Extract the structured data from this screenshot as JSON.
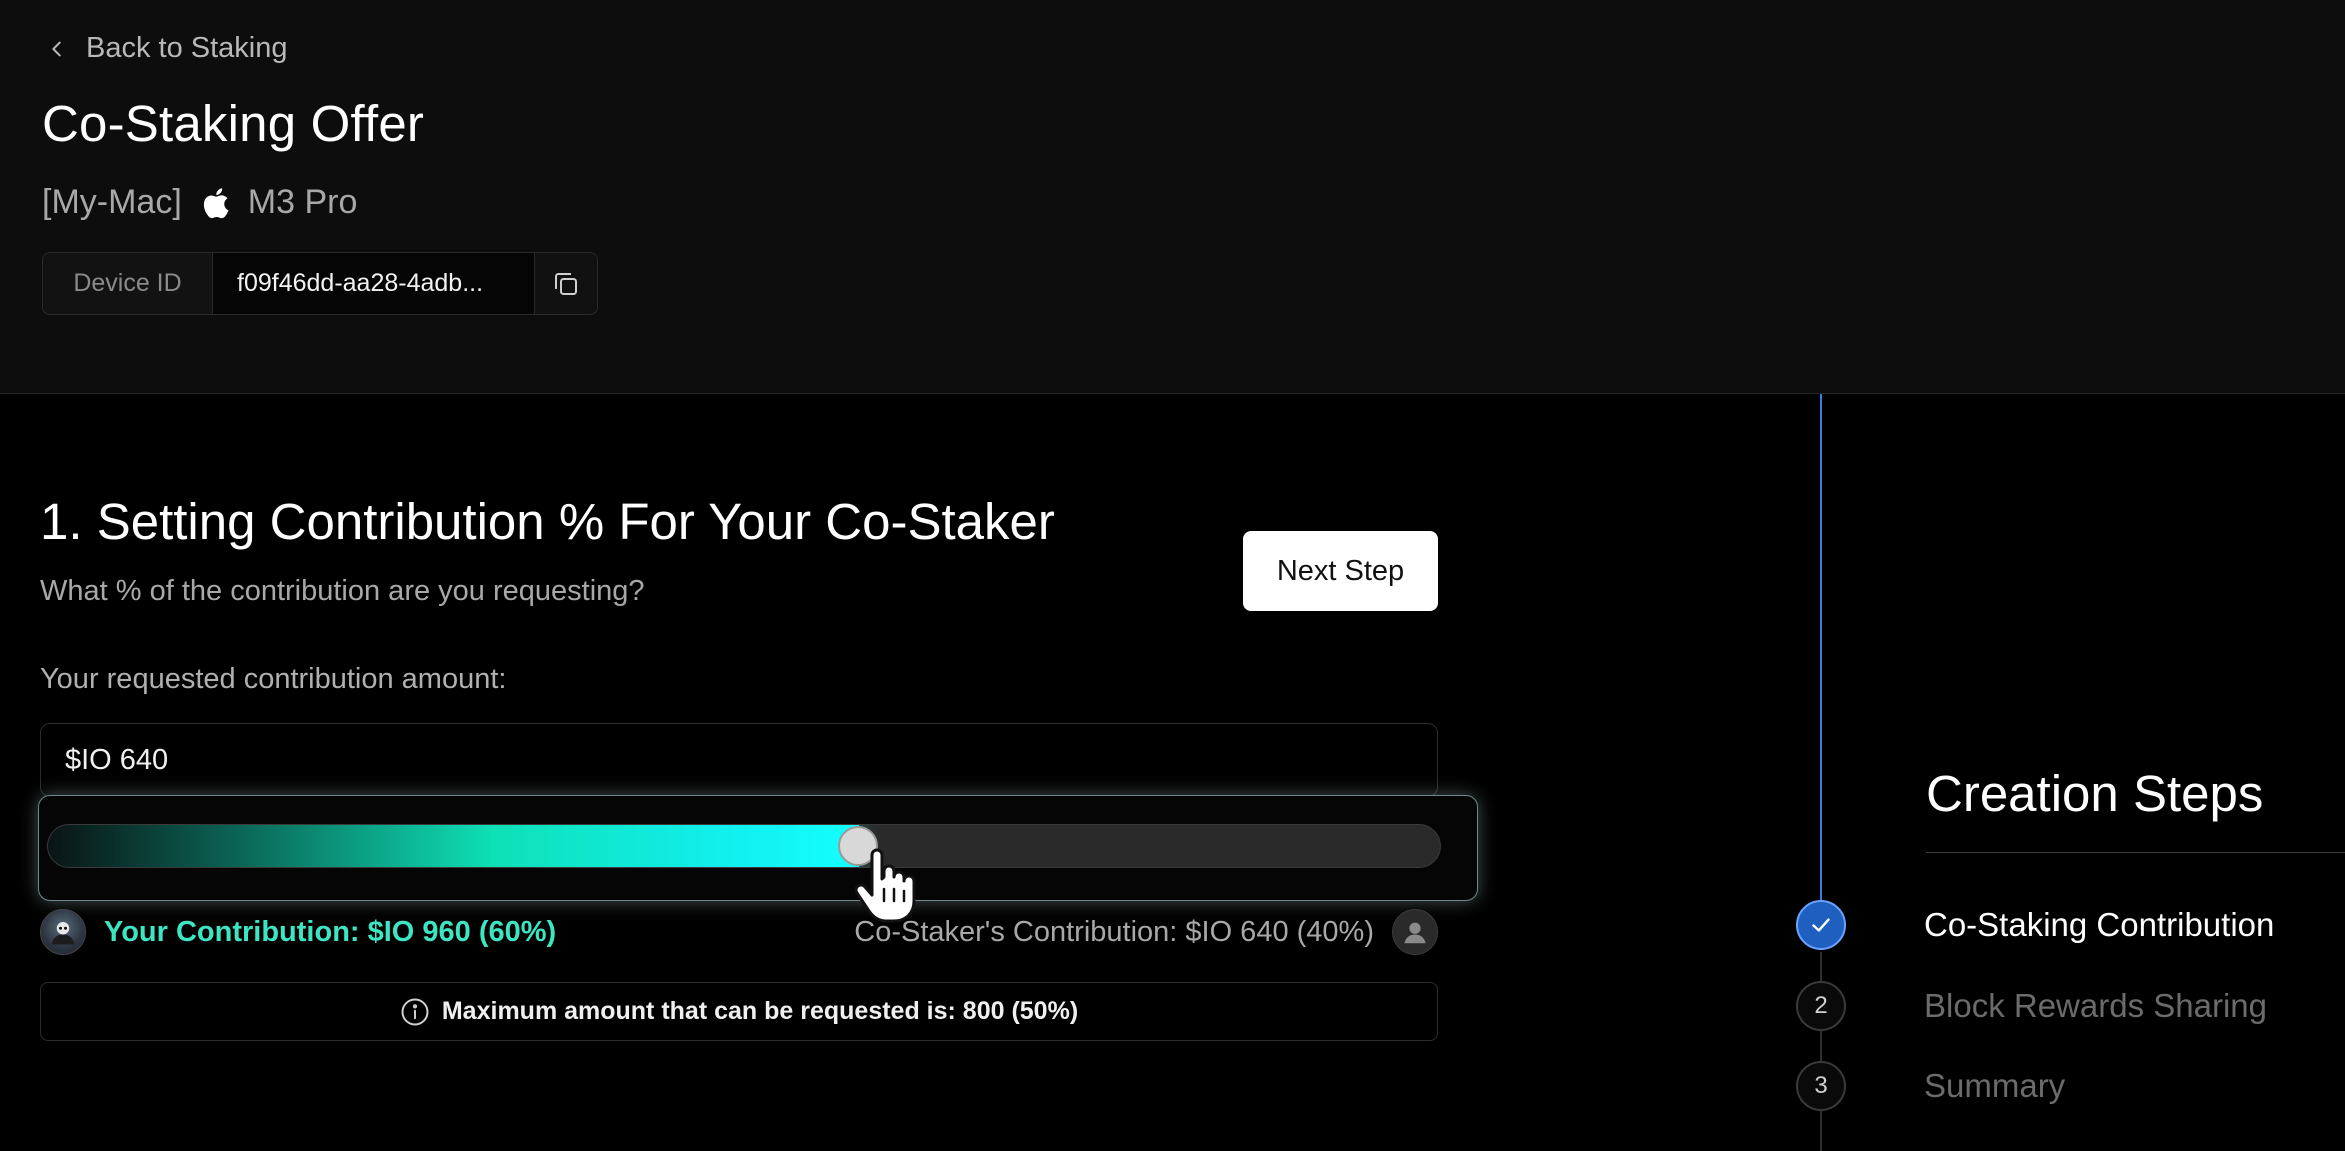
{
  "header": {
    "back_label": "Back to Staking",
    "title": "Co-Staking Offer",
    "device_name": "[My-Mac]",
    "chip": "M3 Pro",
    "device_id_label": "Device ID",
    "device_id_value": "f09f46dd-aa28-4adb..."
  },
  "main": {
    "section_title": "1. Setting Contribution % For Your Co-Staker",
    "section_subtitle": "What % of the contribution are you requesting?",
    "next_button": "Next Step",
    "amount_label": "Your requested contribution amount:",
    "amount_value": "$IO 640",
    "slider_fraction": 0.6,
    "your_contribution": "Your Contribution: $IO 960 (60%)",
    "costaker_contribution": "Co-Staker's Contribution: $IO 640 (40%)",
    "info_text": "Maximum amount that can be requested is: 800 (50%)"
  },
  "steps": {
    "title": "Creation Steps",
    "items": [
      {
        "marker": "",
        "label": "Co-Staking Contribution",
        "state": "done"
      },
      {
        "marker": "2",
        "label": "Block Rewards Sharing",
        "state": "pending"
      },
      {
        "marker": "3",
        "label": "Summary",
        "state": "pending"
      }
    ]
  },
  "colors": {
    "accent_teal": "#3de6c3",
    "step_blue": "#3b7de6",
    "background": "#000000",
    "header_bg": "#0d0d0d"
  }
}
